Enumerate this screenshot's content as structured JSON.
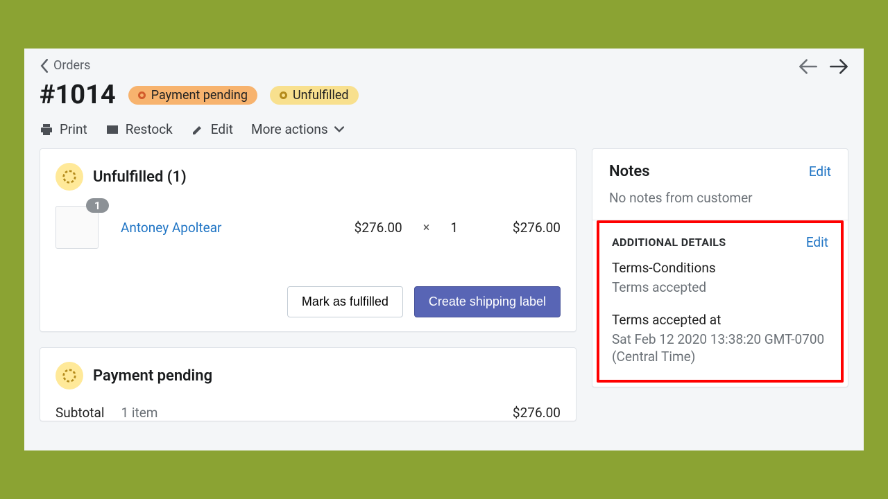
{
  "breadcrumb": {
    "label": "Orders"
  },
  "order": {
    "title": "#1014",
    "badges": {
      "payment": "Payment pending",
      "fulfillment": "Unfulfilled"
    }
  },
  "toolbar": {
    "print": "Print",
    "restock": "Restock",
    "edit": "Edit",
    "more": "More actions"
  },
  "fulfillment_card": {
    "heading": "Unfulfilled (1)",
    "item": {
      "qty_badge": "1",
      "name": "Antoney Apoltear",
      "unit_price": "$276.00",
      "times": "×",
      "qty": "1",
      "line_total": "$276.00"
    },
    "actions": {
      "mark_fulfilled": "Mark as fulfilled",
      "create_label": "Create shipping label"
    }
  },
  "payment_card": {
    "heading": "Payment pending",
    "subtotal_label": "Subtotal",
    "subtotal_desc": "1 item",
    "subtotal_amount": "$276.00"
  },
  "sidebar": {
    "notes": {
      "title": "Notes",
      "edit": "Edit",
      "body": "No notes from customer"
    },
    "additional": {
      "title": "ADDITIONAL DETAILS",
      "edit": "Edit",
      "terms_label": "Terms-Conditions",
      "terms_value": "Terms accepted",
      "accepted_label": "Terms accepted at",
      "accepted_value": "Sat Feb 12 2020 13:38:20 GMT-0700 (Central Time)"
    }
  }
}
